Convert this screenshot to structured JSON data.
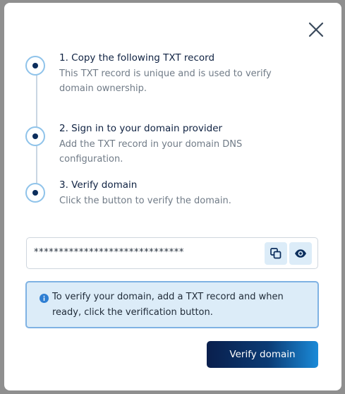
{
  "dialog": {
    "close_icon": "close-icon"
  },
  "steps": [
    {
      "title": "1. Copy the following TXT record",
      "description": "This TXT record is unique and is used to verify domain ownership."
    },
    {
      "title": "2. Sign in to your domain provider",
      "description": "Add the TXT record in your domain DNS configuration."
    },
    {
      "title": "3. Verify domain",
      "description": "Click the button to verify the domain."
    }
  ],
  "token": {
    "value": "******************************",
    "copy_icon": "copy-icon",
    "reveal_icon": "eye-icon"
  },
  "info": {
    "icon": "info-icon",
    "text": "To verify your domain, add a TXT record and when ready, click the verification button."
  },
  "actions": {
    "verify_label": "Verify domain"
  },
  "colors": {
    "accent": "#0b2d5c",
    "info_bg": "#dcecf8",
    "info_border": "#7fb2e3"
  }
}
